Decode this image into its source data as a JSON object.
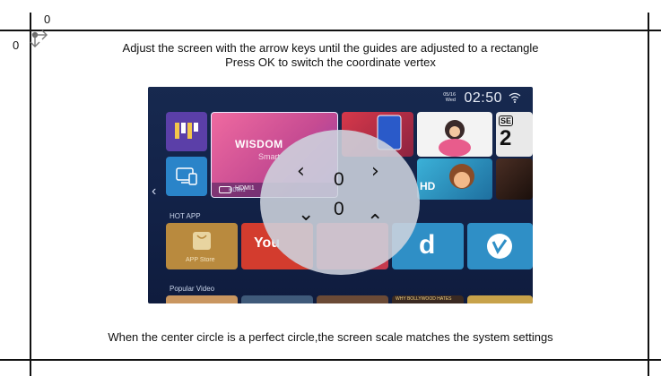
{
  "origin_marks": {
    "x_zero": "0",
    "y_zero": "0"
  },
  "instructions": {
    "line1": "Adjust the screen with the arrow keys until the guides are adjusted to a rectangle",
    "line2": "Press OK to switch the coordinate vertex",
    "bottom": "When the center circle is a perfect circle,the screen scale matches the system settings"
  },
  "preview": {
    "date_line1": "05/16",
    "date_line2": "Wed",
    "time": "02:50",
    "hero_title": "WISDOM",
    "hero_subtitle": "Smart",
    "hdmi_label": "HDMI1",
    "hdmi_label_small": "HDMI1",
    "hot_app_heading": "HOT APP",
    "app_store_label": "APP Store",
    "youtube_label": "You",
    "hd_badge": "HD",
    "se_badge": "SE",
    "se_number": "2",
    "popular_video_heading": "Popular Video",
    "bottom_strip_text": "WHY BOLLYWOOD HATES"
  },
  "center_control": {
    "left_arrow": "‹",
    "right_arrow": "›",
    "down_arrow": "⌄",
    "up_arrow": "⌃",
    "horizontal_value": "0",
    "vertical_value": "0"
  },
  "colors": {
    "guide": "#111111",
    "screen_bg": "#132349",
    "circle": "#ced4de",
    "app_store_tile": "#b98a3e",
    "youtube_tile": "#d33c2e",
    "d_tile": "#2f8fc6",
    "vimeo_tile": "#2f8fc6"
  }
}
